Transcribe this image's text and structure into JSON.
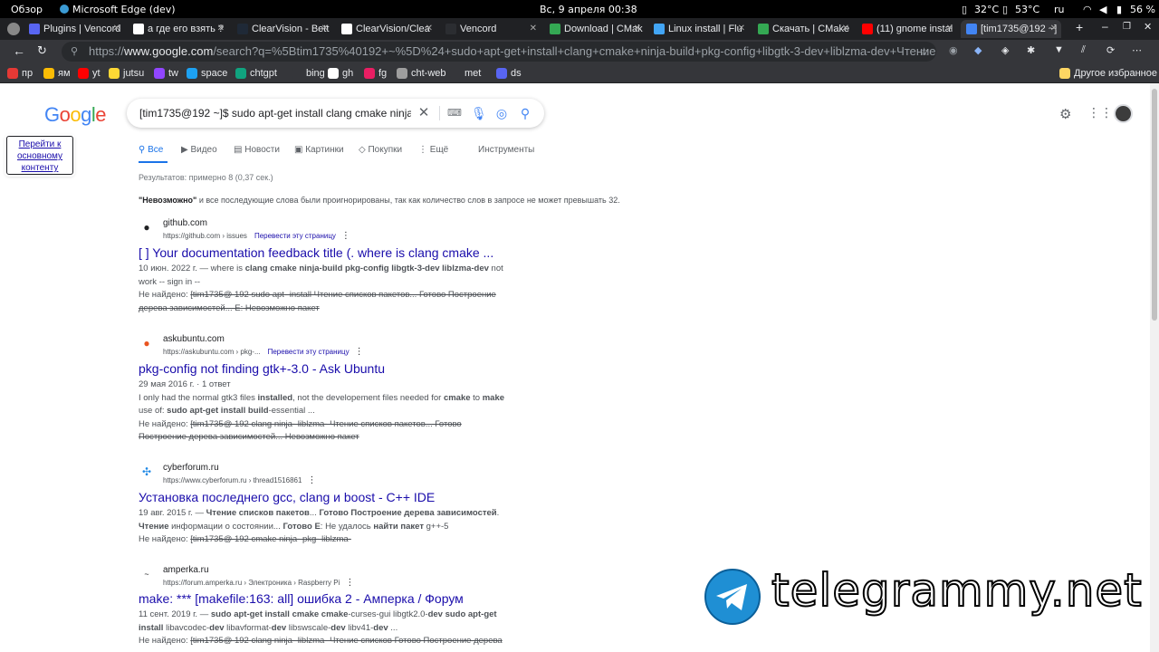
{
  "topbar": {
    "overview": "Обзор",
    "app": "Microsoft Edge (dev)",
    "datetime": "Вс, 9 апреля  00:38",
    "temp1": "32°C",
    "temp2": "53°C",
    "lang": "ru",
    "battery": "56 %"
  },
  "tabs": [
    {
      "label": "Plugins | Vencord",
      "color": "#5865f2"
    },
    {
      "label": "а где его взять ?",
      "color": "#ffffff"
    },
    {
      "label": "ClearVision - Bett",
      "color": "#1f2937"
    },
    {
      "label": "ClearVision/Clea",
      "color": "#ffffff"
    },
    {
      "label": "Vencord",
      "color": "#2b2d31"
    },
    {
      "label": "Download | CMak",
      "color": "#34a853"
    },
    {
      "label": "Linux install | Flu",
      "color": "#42a5f5"
    },
    {
      "label": "Скачать | CMake",
      "color": "#34a853"
    },
    {
      "label": "(11) gnome instal",
      "color": "#ff0000"
    },
    {
      "label": "[tim1735@192 ~]",
      "color": "#4285f4"
    }
  ],
  "address": {
    "prefix": "https://",
    "host": "www.google.com",
    "path": "/search?q=%5Btim1735%40192+~%5D%24+sudo+apt-get+install+clang+cmake+ninja-build+pkg-config+libgtk-3-dev+liblzma-dev+Чтение+списков..."
  },
  "bookmarks": [
    {
      "label": "пр",
      "color": "#e53935"
    },
    {
      "label": "ям",
      "color": "#fbbc05"
    },
    {
      "label": "yt",
      "color": "#ff0000"
    },
    {
      "label": "jutsu",
      "color": "#fdd835"
    },
    {
      "label": "tw",
      "color": "#9146ff"
    },
    {
      "label": "space",
      "color": "#1da1f2"
    },
    {
      "label": "chtgpt",
      "color": "#10a37f"
    },
    {
      "label": "bing",
      "color": "#35363a"
    },
    {
      "label": "gh",
      "color": "#ffffff"
    },
    {
      "label": "fg",
      "color": "#e91e63"
    },
    {
      "label": "cht-web",
      "color": "#9e9e9e"
    },
    {
      "label": "met",
      "color": "#35363a"
    },
    {
      "label": "ds",
      "color": "#5865f2"
    }
  ],
  "bookmarks_other": "Другое избранное",
  "google": {
    "logo": "Google",
    "query": "[tim1735@192 ~]$ sudo apt-get install clang cmake ninja-build pkg-config libgtk-3-dev liblzma-dev",
    "skip": "Перейти к основному контенту"
  },
  "nav": {
    "all": "Все",
    "video": "Видео",
    "news": "Новости",
    "images": "Картинки",
    "shopping": "Покупки",
    "more": "Ещё",
    "tools": "Инструменты"
  },
  "stats": "Результатов: примерно 8 (0,37 сек.)",
  "note_bold": "\"Невозможно\"",
  "note_rest": " и все последующие слова были проигнорированы, так как количество слов в запросе не может превышать 32.",
  "results": [
    {
      "site": "github.com",
      "url": "https://github.com › issues",
      "translate": "Перевести эту страницу",
      "title": "[ ] Your documentation feedback title (. where is clang cmake ...",
      "date": "10 июн. 2022 г. — ",
      "s1": "where is ",
      "s1b": "clang cmake ninja-build pkg-config libgtk-3-dev liblzma-dev",
      "s1c": " not",
      "s2": "work -- sign in --",
      "nf": "Не найдено: ",
      "nf1": "[tim1735@ 192 sudo apt- install Чтение списков пакетов... Готово Построение",
      "nf2": "дерева зависимостей... E: Невозможно пакет"
    },
    {
      "site": "askubuntu.com",
      "url": "https://askubuntu.com › pkg-...",
      "translate": "Перевести эту страницу",
      "title": "pkg-config not finding gtk+-3.0 - Ask Ubuntu",
      "date": "29 мая 2016 г. · 1 ответ",
      "s1": "I only had the normal gtk3 files ",
      "s1b": "installed",
      "s1c": ", not the developement files needed for ",
      "s1d": "cmake",
      "s1e": " to ",
      "s1f": "make",
      "s2a": "use of: ",
      "s2b": "sudo apt-get install build",
      "s2c": "-essential ...",
      "nf": "Не найдено: ",
      "nf1": "[tim1735@ 192 clang ninja- liblzma- Чтение списков пакетов... Готово",
      "nf2": "Построение дерева зависимостей... Невозможно пакет"
    },
    {
      "site": "cyberforum.ru",
      "url": "https://www.cyberforum.ru › thread1516861",
      "title": "Установка последнего gcc, clang и boost - C++ IDE",
      "date": "19 авг. 2015 г. — ",
      "s1b": "Чтение списков пакетов",
      "s1c": "... ",
      "s1d": "Готово Построение дерева зависимостей",
      "s1e": ".",
      "s2b": "Чтение",
      "s2c": " информации о состоянии... ",
      "s2d": "Готово E",
      "s2e": ": Не удалось ",
      "s2f": "найти пакет",
      "s2g": " g++-5",
      "nf": "Не найдено: ",
      "nf1": "[tim1735@ 192 cmake ninja- pkg- liblzma-"
    },
    {
      "site": "amperka.ru",
      "url": "https://forum.amperka.ru › Электроника › Raspberry Pi",
      "title": "make: *** [makefile:163: all] ошибка 2 - Амперка / Форум",
      "date": "11 сент. 2019 г. — ",
      "s1b": "sudo apt-get install cmake cmake",
      "s1c": "-curses-gui libgtk2.0-",
      "s1d": "dev sudo apt-get",
      "s2b": "install",
      "s2c": " libavcodec-",
      "s2d": "dev",
      "s2e": " libavformat-",
      "s2f": "dev",
      "s2g": " libswscale-",
      "s2h": "dev",
      "s2i": " libv41-",
      "s2j": "dev",
      "s2k": " ...",
      "nf": "Не найдено: ",
      "nf1": "[tim1735@ 192 clang ninja- liblzma- Чтение списков Готово Построение дерева"
    }
  ],
  "watermark": "telegrammy.net"
}
